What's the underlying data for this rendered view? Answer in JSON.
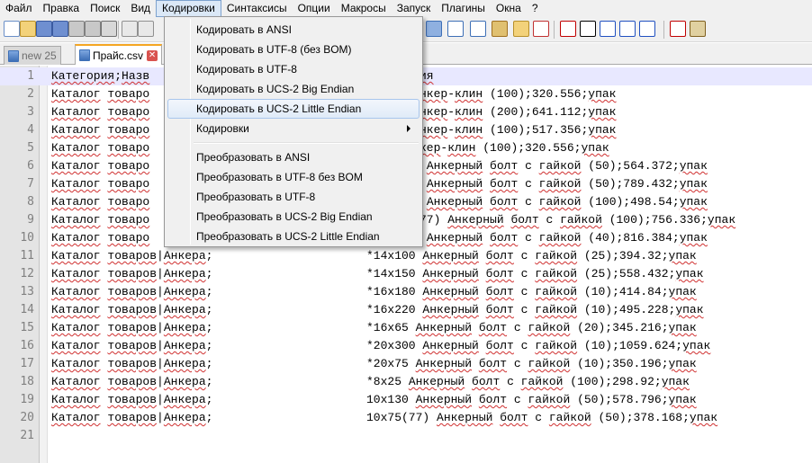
{
  "menu": [
    "Файл",
    "Правка",
    "Поиск",
    "Вид",
    "Кодировки",
    "Синтаксисы",
    "Опции",
    "Макросы",
    "Запуск",
    "Плагины",
    "Окна",
    "?"
  ],
  "menu_active_index": 4,
  "tabs": [
    {
      "label": "new  25",
      "active": false
    },
    {
      "label": "Прайс.csv",
      "active": true
    }
  ],
  "dropdown": {
    "items": [
      {
        "label": "Кодировать в ANSI"
      },
      {
        "label": "Кодировать в UTF-8 (без BOM)"
      },
      {
        "label": "Кодировать в UTF-8"
      },
      {
        "label": "Кодировать в UCS-2 Big Endian"
      },
      {
        "label": "Кодировать в UCS-2 Little Endian",
        "hovered": true
      },
      {
        "label": "Кодировки",
        "submenu": true
      },
      {
        "label": "Преобразовать в ANSI"
      },
      {
        "label": "Преобразовать в UTF-8 без BOM"
      },
      {
        "label": "Преобразовать в UTF-8"
      },
      {
        "label": "Преобразовать в UCS-2 Big Endian"
      },
      {
        "label": "Преобразовать в UCS-2 Little Endian"
      }
    ]
  },
  "editor": {
    "lines": [
      {
        "num": "1",
        "left": "Категория;Назв",
        "right": "ия"
      },
      {
        "num": "2",
        "left": "Каталог товаро",
        "right": "нкер-клин (100);320.556;упак"
      },
      {
        "num": "3",
        "left": "Каталог товаро",
        "right": "нкер-клин (200);641.112;упак"
      },
      {
        "num": "4",
        "left": "Каталог товаро",
        "right": "нкер-клин (100);517.356;упак"
      },
      {
        "num": "5",
        "left": "Каталог товаро",
        "right": "кер-клин (100);320.556;упак"
      },
      {
        "num": "6",
        "left": "Каталог товаро",
        "right": " Анкерный болт с гайкой (50);564.372;упак"
      },
      {
        "num": "7",
        "left": "Каталог товаро",
        "right": " Анкерный болт с гайкой (50);789.432;упак"
      },
      {
        "num": "8",
        "left": "Каталог товаро",
        "right": " Анкерный болт с гайкой (100);498.54;упак"
      },
      {
        "num": "9",
        "left": "Каталог товаро",
        "right": "77) Анкерный болт с гайкой (100);756.336;упак"
      },
      {
        "num": "10",
        "left": "Каталог товаро",
        "right": " Анкерный болт с гайкой (40);816.384;упак"
      },
      {
        "num": "11",
        "left": "Каталог товаров|Анкера;",
        "right": "*14x100 Анкерный болт с гайкой (25);394.32;упак"
      },
      {
        "num": "12",
        "left": "Каталог товаров|Анкера;",
        "right": "*14x150 Анкерный болт с гайкой (25);558.432;упак"
      },
      {
        "num": "13",
        "left": "Каталог товаров|Анкера;",
        "right": "*16x180 Анкерный болт с гайкой (10);414.84;упак"
      },
      {
        "num": "14",
        "left": "Каталог товаров|Анкера;",
        "right": "*16x220 Анкерный болт с гайкой (10);495.228;упак"
      },
      {
        "num": "15",
        "left": "Каталог товаров|Анкера;",
        "right": "*16x65 Анкерный болт с гайкой (20);345.216;упак"
      },
      {
        "num": "16",
        "left": "Каталог товаров|Анкера;",
        "right": "*20x300 Анкерный болт с гайкой (10);1059.624;упак"
      },
      {
        "num": "17",
        "left": "Каталог товаров|Анкера;",
        "right": "*20x75 Анкерный болт с гайкой (10);350.196;упак"
      },
      {
        "num": "18",
        "left": "Каталог товаров|Анкера;",
        "right": "*8x25 Анкерный болт с гайкой (100);298.92;упак"
      },
      {
        "num": "19",
        "left": "Каталог товаров|Анкера;",
        "right": "10x130 Анкерный болт с гайкой (50);578.796;упак"
      },
      {
        "num": "20",
        "left": "Каталог товаров|Анкера;",
        "right": "10x75(77) Анкерный болт с гайкой (50);378.168;упак"
      },
      {
        "num": "21",
        "left": "",
        "right": ""
      }
    ]
  }
}
